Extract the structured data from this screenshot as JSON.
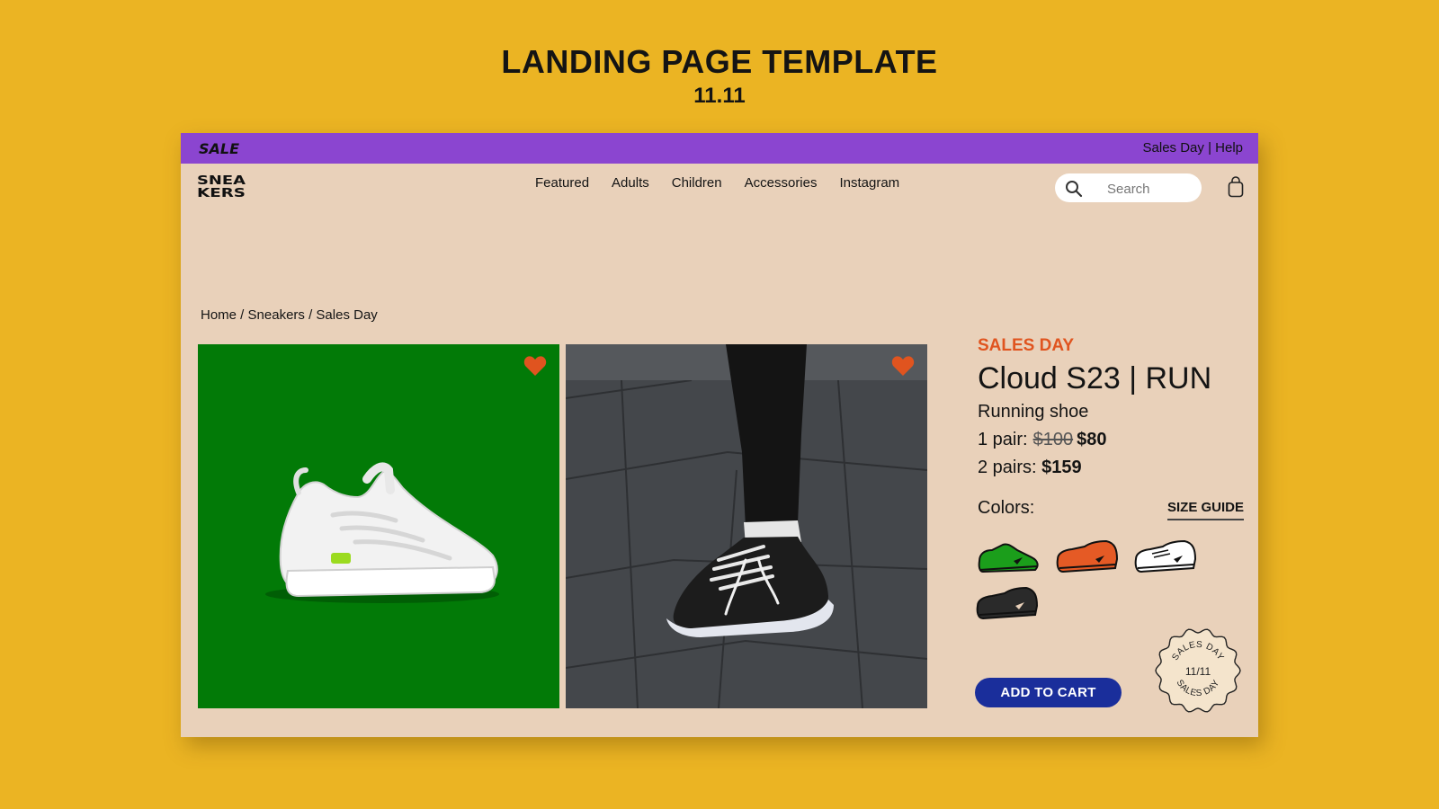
{
  "heading": {
    "title": "LANDING PAGE TEMPLATE",
    "subtitle": "11.11"
  },
  "topbar": {
    "logo_text": "SALE",
    "link_sales_day": "Sales Day",
    "separator": "|",
    "link_help": "Help",
    "background": "#8B45D0"
  },
  "brand": {
    "logo_text": "SNEAKERS"
  },
  "nav": {
    "items": [
      {
        "label": "Featured"
      },
      {
        "label": "Adults"
      },
      {
        "label": "Children"
      },
      {
        "label": "Accessories"
      },
      {
        "label": "Instagram"
      }
    ]
  },
  "search": {
    "placeholder": "Search",
    "icon": "search-icon"
  },
  "cart": {
    "icon": "shopping-bag-icon"
  },
  "breadcrumb": {
    "items": [
      "Home",
      "Sneakers",
      "Sales Day"
    ],
    "separator": " / "
  },
  "gallery": [
    {
      "background": "#027A07",
      "favorite_icon": "heart-icon"
    },
    {
      "background": "#3F4144",
      "favorite_icon": "heart-icon"
    }
  ],
  "product": {
    "promo_label": "SALES DAY",
    "name": "Cloud S23 | RUN",
    "type": "Running shoe",
    "price_one_label": "1 pair:",
    "price_one_old": "$100",
    "price_one_new": "$80",
    "price_two_label": "2 pairs:",
    "price_two": "$159",
    "colors_label": "Colors:",
    "size_guide_label": "SIZE GUIDE",
    "colors": [
      {
        "name": "green",
        "hex": "#1B9E1B"
      },
      {
        "name": "orange",
        "hex": "#E55A25"
      },
      {
        "name": "white",
        "hex": "#FFFFFF"
      },
      {
        "name": "black",
        "hex": "#2A2A2A"
      }
    ],
    "add_to_cart_label": "ADD TO CART"
  },
  "badge": {
    "top_text": "SALES DAY",
    "center_text": "11/11",
    "bottom_text": "SALES DAY"
  },
  "colors": {
    "page_bg": "#EBB423",
    "mockup_bg": "#E9D1BA",
    "accent_orange": "#E0541F",
    "button_blue": "#1A2E9B"
  }
}
